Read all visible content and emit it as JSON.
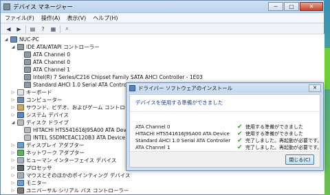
{
  "window": {
    "title": "デバイス マネージャー",
    "min": "─",
    "max": "□",
    "close": "✕"
  },
  "menu": [
    "ファイル(F)",
    "操作(A)",
    "表示(V)",
    "ヘルプ(H)"
  ],
  "toolbar_icons": [
    "back-arrow-icon",
    "forward-arrow-icon",
    "properties-icon",
    "help-icon",
    "view-icon",
    "scan-icon",
    "update-icon"
  ],
  "tree": {
    "root": "NUC-PC",
    "ide": "IDE ATA/ATAPI コントローラー",
    "ide_children": [
      "ATA Channel 0",
      "ATA Channel 0",
      "ATA Channel 1",
      "Intel(R) 7 Series/C216 Chipset Family SATA AHCI Controller - 1E03",
      "Standard AHCI 1.0 Serial ATA Controller"
    ],
    "keyboard": "キーボード",
    "computer": "コンピューター",
    "sound": "サウンド、ビデオ、およびゲーム コントローラー",
    "system": "システム デバイス",
    "disk": "ディスク ドライブ",
    "disk_children": [
      "HITACHI HTS541616J9SA00 ATA Device",
      "INTEL SSDMCEAC120B3 ATA Device"
    ],
    "display": "ディスプレイ アダプター",
    "network": "ネットワーク アダプター",
    "hid": "ヒューマン インターフェイス デバイス",
    "processor": "プロセッサ",
    "mouse": "マウスとそのほかのポインティング デバイス",
    "monitor": "モニター",
    "usb": "ユニバーサル シリアル バス コントローラー"
  },
  "dialog": {
    "title": "ドライバー ソフトウェアのインストール",
    "close": "✕",
    "heading": "デバイスを使用する準備ができました",
    "rows": [
      {
        "device": "ATA Channel 0",
        "status": "使用する準備ができました"
      },
      {
        "device": "HITACHI HTS541616J9SA00 ATA Device",
        "status": "使用する準備ができました"
      },
      {
        "device": "Standard AHCI 1.0 Serial ATA Controller",
        "status": "完了しました。再起動が必要です。"
      },
      {
        "device": "ATA Channel 1",
        "status": "完了しました。再起動が必要です。"
      }
    ],
    "check": "✔",
    "close_button": "閉じる(C)"
  }
}
